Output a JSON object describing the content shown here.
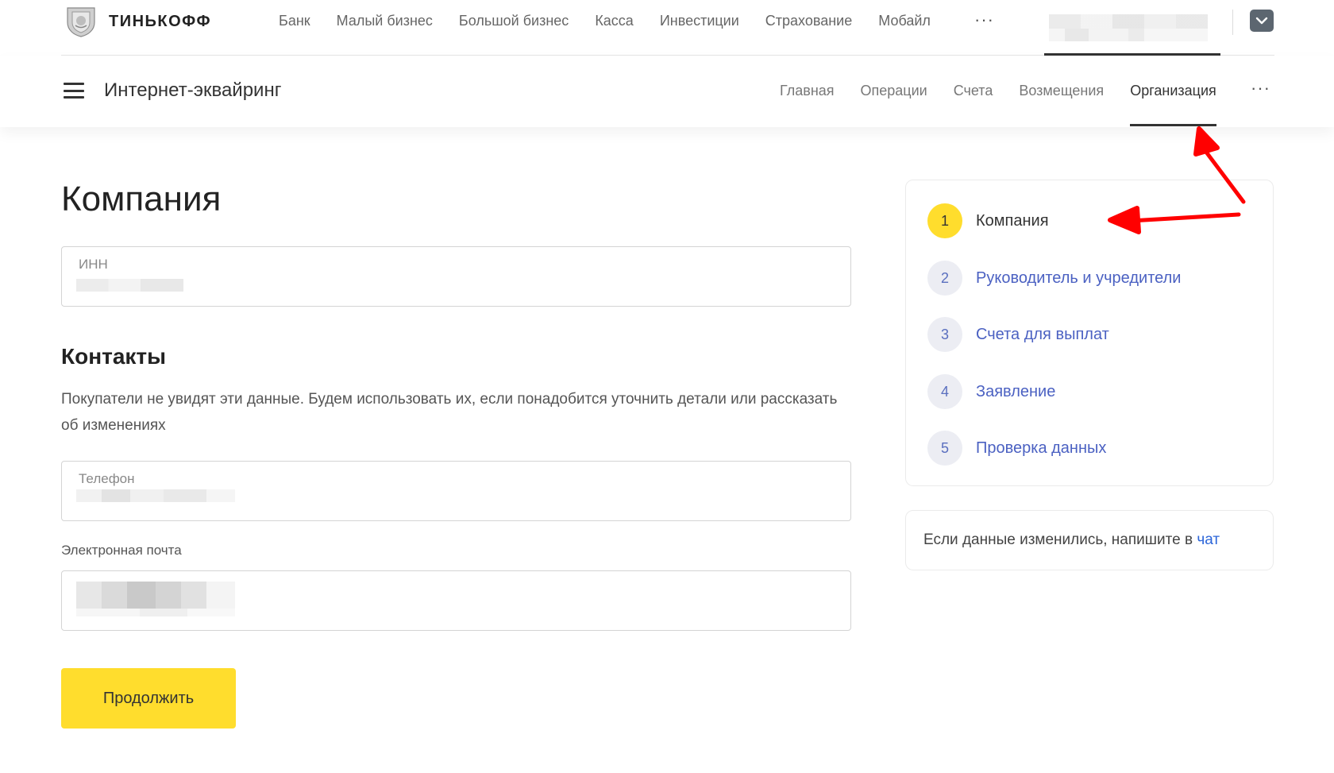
{
  "topbar": {
    "brand": "ТИНЬКОФФ",
    "nav": [
      "Банк",
      "Малый бизнес",
      "Большой бизнес",
      "Касса",
      "Инвестиции",
      "Страхование",
      "Мобайл"
    ],
    "more_label": "···",
    "dropdown_icon": "chevron-down-icon"
  },
  "productbar": {
    "menu_icon": "hamburger-menu-icon",
    "title": "Интернет-эквайринг",
    "nav": [
      "Главная",
      "Операции",
      "Счета",
      "Возмещения",
      "Организация"
    ],
    "active_tab": "Организация",
    "more_label": "···"
  },
  "form": {
    "title": "Компания",
    "inn_label": "ИНН",
    "contacts_title": "Контакты",
    "contacts_desc": "Покупатели не увидят эти данные. Будем использовать их, если понадобится уточнить детали или рассказать об изменениях",
    "phone_label": "Телефон",
    "email_label": "Электронная почта",
    "continue_label": "Продолжить"
  },
  "steps": [
    {
      "num": "1",
      "label": "Компания",
      "state": "current"
    },
    {
      "num": "2",
      "label": "Руководитель и учредители",
      "state": "pending"
    },
    {
      "num": "3",
      "label": "Счета для выплат",
      "state": "pending"
    },
    {
      "num": "4",
      "label": "Заявление",
      "state": "pending"
    },
    {
      "num": "5",
      "label": "Проверка данных",
      "state": "pending"
    }
  ],
  "chat": {
    "text": "Если данные изменились, напишите в",
    "link": "чат"
  },
  "colors": {
    "accent_yellow": "#ffdd2d",
    "link_blue": "#4b61c2",
    "annotation_red": "#ff0000"
  }
}
